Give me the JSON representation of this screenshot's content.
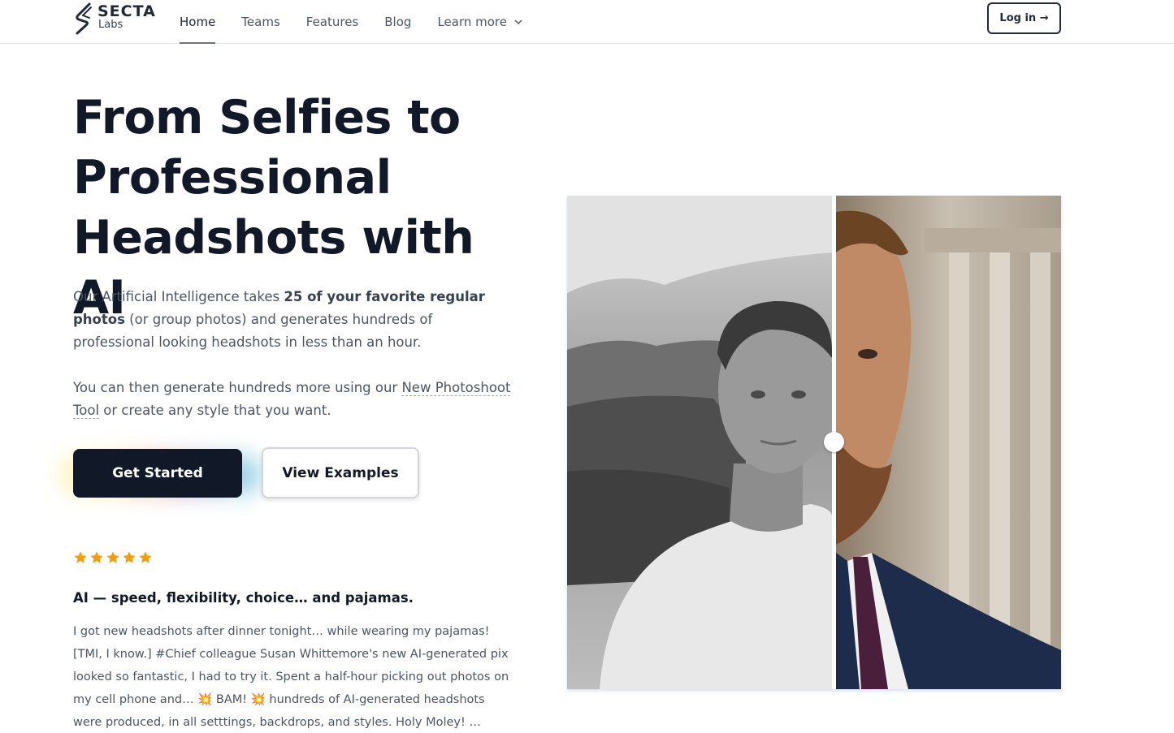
{
  "brand": {
    "name": "SECTA",
    "sub": "Labs"
  },
  "nav": {
    "items": [
      {
        "label": "Home"
      },
      {
        "label": "Teams"
      },
      {
        "label": "Features"
      },
      {
        "label": "Blog"
      },
      {
        "label": "Learn more"
      }
    ],
    "login": "Log in →"
  },
  "hero": {
    "title_line1": "From Selfies to",
    "title_line2": "Professional",
    "title_line3": "Headshots with AI",
    "p1_a": "Our Artificial Intelligence takes ",
    "p1_bold": "25 of your favorite regular photos",
    "p1_b": " (or group photos) and generates hundreds of professional looking headshots in less than an hour.",
    "p2_a": "You can then generate hundreds more using our ",
    "p2_link": "New Photoshoot Tool",
    "p2_b": " or create any style that you want.",
    "cta_primary": "Get Started",
    "cta_secondary": "View Examples"
  },
  "review": {
    "stars": 5,
    "title": "AI — speed, flexibility, choice… and pajamas.",
    "body": "I got new headshots after dinner tonight… while wearing my pajamas! [TMI, I know.] #Chief colleague Susan Whittemore's new AI-generated pix looked so fantastic, I had to try it. Spent a half-hour picking out photos on my cell phone and… 💥 BAM! 💥 hundreds of AI-generated headshots were produced, in all setttings, backdrops, and styles. Holy Moley! …"
  },
  "colors": {
    "primary": "#111827",
    "star": "#f59e0b",
    "accent_border": "#1f2937"
  }
}
